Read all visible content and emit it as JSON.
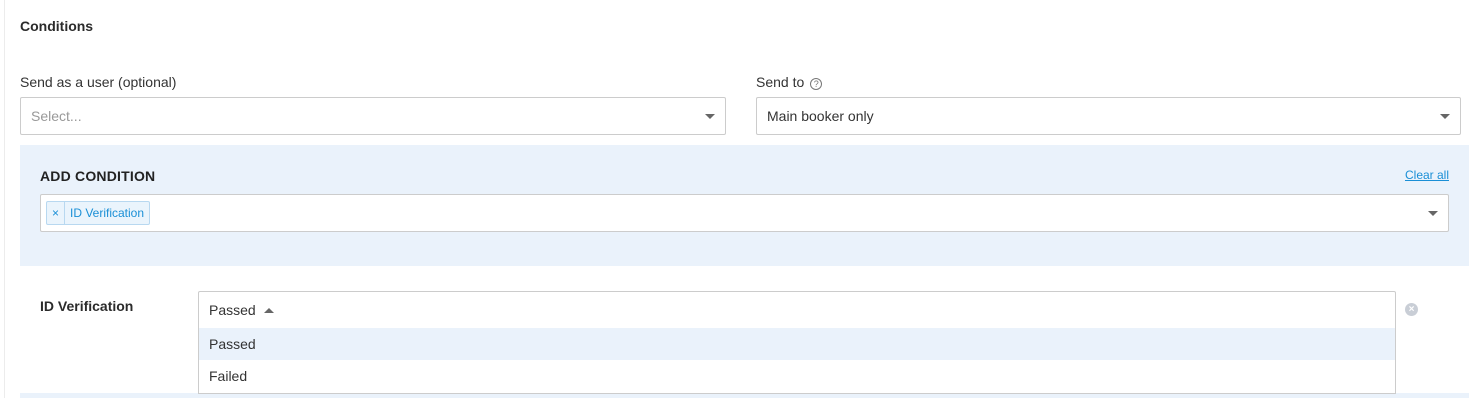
{
  "conditions_section": {
    "title": "Conditions"
  },
  "send_as_user": {
    "label": "Send as a user (optional)",
    "placeholder": "Select..."
  },
  "send_to": {
    "label": "Send to",
    "help_icon": "question-circle-icon",
    "value": "Main booker only"
  },
  "add_condition": {
    "title": "ADD CONDITION",
    "clear_all": "Clear all",
    "tags": [
      {
        "label": "ID Verification",
        "remove_symbol": "×"
      }
    ]
  },
  "id_verification": {
    "label": "ID Verification",
    "selected": "Passed",
    "options": [
      "Passed",
      "Failed"
    ],
    "remove_icon": "close-circle-icon"
  },
  "colors": {
    "panel_bg": "#eaf2fb",
    "link": "#1a8fd6",
    "border": "#cccccc"
  }
}
